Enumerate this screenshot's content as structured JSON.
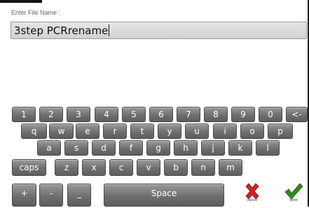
{
  "field": {
    "label": "Enter File Name :",
    "value": "3step PCRrename"
  },
  "keyboard": {
    "row1": [
      "1",
      "2",
      "3",
      "4",
      "5",
      "6",
      "7",
      "8",
      "9",
      "0",
      "<-"
    ],
    "row2": [
      "q",
      "w",
      "e",
      "r",
      "t",
      "y",
      "u",
      "i",
      "o",
      "p"
    ],
    "row3": [
      "a",
      "s",
      "d",
      "f",
      "g",
      "h",
      "j",
      "k",
      "l"
    ],
    "row4": [
      "caps",
      "z",
      "x",
      "c",
      "v",
      "b",
      "n",
      "m"
    ],
    "row5": [
      "+",
      "-",
      "_",
      "Space"
    ]
  },
  "actions": {
    "cancel": {
      "label": "cancel",
      "icon": "x-icon",
      "color": "#d42020"
    },
    "done": {
      "label": "done",
      "icon": "checkmark-icon",
      "color": "#2a8a1a"
    }
  }
}
